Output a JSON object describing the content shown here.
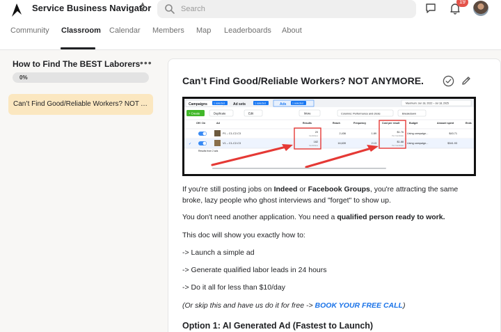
{
  "app": {
    "name": "Service Business Navigator",
    "search_placeholder": "Search",
    "notification_count": "19"
  },
  "nav": {
    "tabs": [
      "Community",
      "Classroom",
      "Calendar",
      "Members",
      "Map",
      "Leaderboards",
      "About"
    ],
    "active": "Classroom"
  },
  "sidebar": {
    "course_title": "How to Find The BEST Laborers",
    "progress_label": "0%",
    "progress": 0,
    "lessons": [
      "Can’t Find Good/Reliable Workers? NOT A..."
    ]
  },
  "lesson": {
    "title": "Can’t Find Good/Reliable Workers? NOT ANYMORE.",
    "p1_a": "If you're still posting jobs on ",
    "p1_b": "Indeed",
    "p1_c": " or ",
    "p1_d": "Facebook Groups",
    "p1_e": ", you're attracting the same broke, lazy people who ghost interviews and \"forget\" to show up.",
    "p2_a": "You don't need another application. You need a ",
    "p2_b": "qualified person ready to work.",
    "p3": "This doc will show you exactly how to:",
    "bullets": [
      "-> Launch a simple ad",
      "-> Generate qualified labor leads in 24 hours",
      "-> Do it all for less than $10/day"
    ],
    "p4_a": "(Or skip this and have us do it for free -> ",
    "p4_link": "BOOK YOUR FREE CALL",
    "p4_b": ")",
    "option_heading": "Option 1: AI Generated Ad (Fastest to Launch)"
  },
  "ads_screenshot": {
    "tabs": [
      "Campaigns",
      "1 selected",
      "Ad sets",
      "1 selected",
      "Ads",
      "1 selected"
    ],
    "date_range": "Maximum: Jun 18, 2022 – Jul 18, 2025",
    "toolbar": [
      "+ Create",
      "Duplicate",
      "Edit",
      "More",
      "Columns: Performance and clicks",
      "Breakdown"
    ],
    "columns": [
      "Off / On",
      "Ad",
      "Results",
      "Reach",
      "Frequency",
      "Cost per result",
      "Budget",
      "Amount spent",
      "Ends"
    ],
    "rows": [
      {
        "ad": "P1 – C1-C2-C3",
        "results": "20",
        "results_sub": "Candidates",
        "reach": "2,436",
        "frequency": "1.89",
        "cpr": "$1.76",
        "cpr_sub": "Per Candidate",
        "budget": "Using campaign...",
        "spent": "$43.71"
      },
      {
        "ad": "V1 – C1-C2-C3",
        "results": "182",
        "results_sub": "Candidates",
        "reach": "16,639",
        "frequency": "2.13",
        "cpr": "$1.88",
        "cpr_sub": "Per Candidate",
        "budget": "Using campaign...",
        "spent": "$341.93"
      }
    ],
    "footer": "Results from 2 ads",
    "accent": "#1877f2",
    "highlight": "#e53935"
  }
}
